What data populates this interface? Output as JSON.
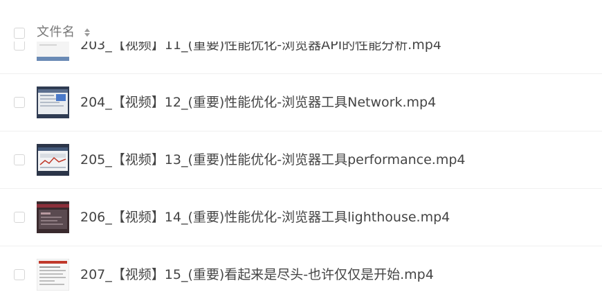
{
  "header": {
    "column_label": "文件名"
  },
  "files": [
    {
      "name": "203_【视频】11_(重要)性能优化-浏览器API的性能分析.mp4"
    },
    {
      "name": "204_【视频】12_(重要)性能优化-浏览器工具Network.mp4"
    },
    {
      "name": "205_【视频】13_(重要)性能优化-浏览器工具performance.mp4"
    },
    {
      "name": "206_【视频】14_(重要)性能优化-浏览器工具lighthouse.mp4"
    },
    {
      "name": "207_【视频】15_(重要)看起来是尽头-也许仅仅是开始.mp4"
    }
  ]
}
